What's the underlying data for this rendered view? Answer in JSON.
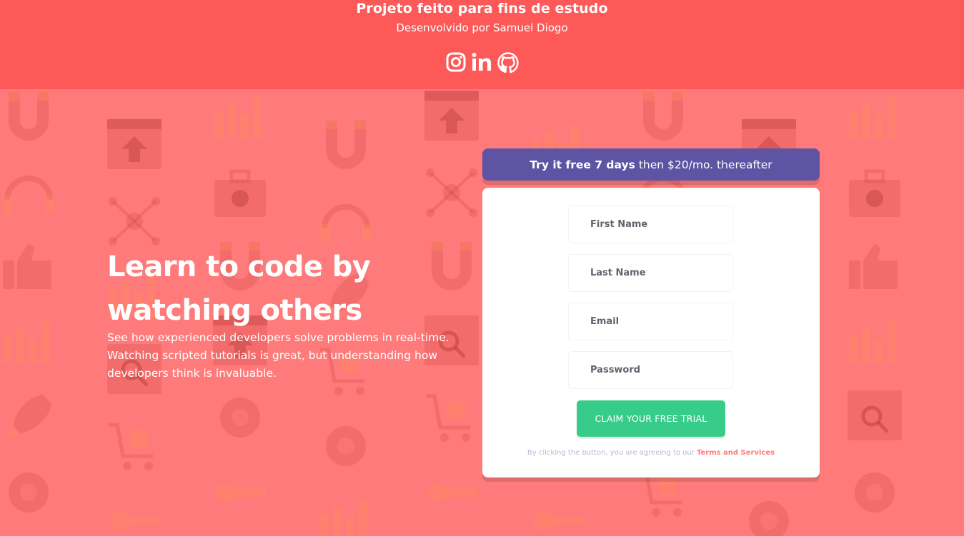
{
  "header": {
    "title": "Projeto feito para fins de estudo",
    "subtitle": "Desenvolvido por Samuel Diogo",
    "social_icons": [
      "instagram-icon",
      "linkedin-icon",
      "github-icon"
    ]
  },
  "hero": {
    "title_line1": "Learn to code by",
    "title_line2": "watching others",
    "text_line1": "See how experienced developers solve problems in real-time.",
    "text_line2": "Watching scripted tutorials is great, but understanding how",
    "text_line3": "developers think is invaluable."
  },
  "promo": {
    "bold": "Try it free 7 days",
    "rest": "then $20/mo. thereafter"
  },
  "form": {
    "first_name_placeholder": "First Name",
    "last_name_placeholder": "Last Name",
    "email_placeholder": "Email",
    "password_placeholder": "Password",
    "submit_label": "CLAIM YOUR FREE TRIAL",
    "terms_text": "By clicking the button, you are agreeing to our",
    "terms_link": "Terms and Services"
  },
  "colors": {
    "header_bg": "#fd5959",
    "body_bg": "#ff7a7a",
    "promo_bg": "#5e54a4",
    "button_bg": "#38cc8b",
    "link": "#ff7a7a"
  }
}
